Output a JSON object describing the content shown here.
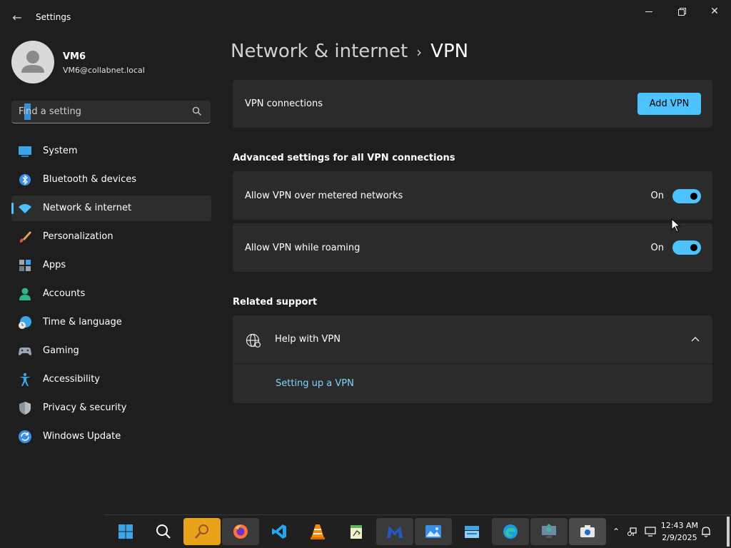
{
  "window": {
    "app_title": "Settings",
    "back_glyph": "←",
    "minimize_glyph": "—",
    "maximize_glyph": "❐",
    "close_glyph": "✕"
  },
  "user": {
    "name": "VM6",
    "email": "VM6@collabnet.local"
  },
  "search": {
    "value": "Find a setting"
  },
  "sidebar": {
    "items": [
      {
        "label": "System",
        "icon": "system-icon"
      },
      {
        "label": "Bluetooth & devices",
        "icon": "bluetooth-icon"
      },
      {
        "label": "Network & internet",
        "icon": "wifi-icon",
        "active": true
      },
      {
        "label": "Personalization",
        "icon": "brush-icon"
      },
      {
        "label": "Apps",
        "icon": "apps-icon"
      },
      {
        "label": "Accounts",
        "icon": "accounts-icon"
      },
      {
        "label": "Time & language",
        "icon": "globe-clock-icon"
      },
      {
        "label": "Gaming",
        "icon": "gamepad-icon"
      },
      {
        "label": "Accessibility",
        "icon": "accessibility-icon"
      },
      {
        "label": "Privacy & security",
        "icon": "shield-icon"
      },
      {
        "label": "Windows Update",
        "icon": "update-icon"
      }
    ]
  },
  "breadcrumb": {
    "parent": "Network & internet",
    "separator": "›",
    "current": "VPN"
  },
  "vpn": {
    "connections_label": "VPN connections",
    "add_button": "Add VPN"
  },
  "advanced": {
    "title": "Advanced settings for all VPN connections",
    "metered_label": "Allow VPN over metered networks",
    "metered_state": "On",
    "roaming_label": "Allow VPN while roaming",
    "roaming_state": "On"
  },
  "support": {
    "title": "Related support",
    "help_label": "Help with VPN",
    "link_label": "Setting up a VPN"
  },
  "taskbar": {
    "time": "12:43 AM",
    "date": "2/9/2025",
    "chevron_glyph": "⌃"
  },
  "colors": {
    "accent": "#4cc2ff",
    "background": "#1e1e1e",
    "card": "#2b2b2b"
  }
}
